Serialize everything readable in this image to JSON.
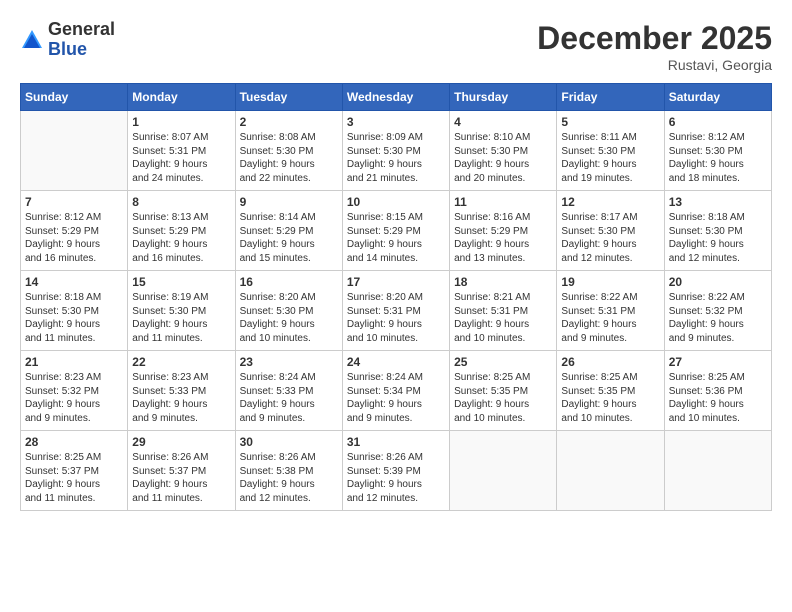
{
  "header": {
    "logo_general": "General",
    "logo_blue": "Blue",
    "month_title": "December 2025",
    "location": "Rustavi, Georgia"
  },
  "days_of_week": [
    "Sunday",
    "Monday",
    "Tuesday",
    "Wednesday",
    "Thursday",
    "Friday",
    "Saturday"
  ],
  "weeks": [
    [
      {
        "day": "",
        "info": ""
      },
      {
        "day": "1",
        "info": "Sunrise: 8:07 AM\nSunset: 5:31 PM\nDaylight: 9 hours\nand 24 minutes."
      },
      {
        "day": "2",
        "info": "Sunrise: 8:08 AM\nSunset: 5:30 PM\nDaylight: 9 hours\nand 22 minutes."
      },
      {
        "day": "3",
        "info": "Sunrise: 8:09 AM\nSunset: 5:30 PM\nDaylight: 9 hours\nand 21 minutes."
      },
      {
        "day": "4",
        "info": "Sunrise: 8:10 AM\nSunset: 5:30 PM\nDaylight: 9 hours\nand 20 minutes."
      },
      {
        "day": "5",
        "info": "Sunrise: 8:11 AM\nSunset: 5:30 PM\nDaylight: 9 hours\nand 19 minutes."
      },
      {
        "day": "6",
        "info": "Sunrise: 8:12 AM\nSunset: 5:30 PM\nDaylight: 9 hours\nand 18 minutes."
      }
    ],
    [
      {
        "day": "7",
        "info": "Sunrise: 8:12 AM\nSunset: 5:29 PM\nDaylight: 9 hours\nand 16 minutes."
      },
      {
        "day": "8",
        "info": "Sunrise: 8:13 AM\nSunset: 5:29 PM\nDaylight: 9 hours\nand 16 minutes."
      },
      {
        "day": "9",
        "info": "Sunrise: 8:14 AM\nSunset: 5:29 PM\nDaylight: 9 hours\nand 15 minutes."
      },
      {
        "day": "10",
        "info": "Sunrise: 8:15 AM\nSunset: 5:29 PM\nDaylight: 9 hours\nand 14 minutes."
      },
      {
        "day": "11",
        "info": "Sunrise: 8:16 AM\nSunset: 5:29 PM\nDaylight: 9 hours\nand 13 minutes."
      },
      {
        "day": "12",
        "info": "Sunrise: 8:17 AM\nSunset: 5:30 PM\nDaylight: 9 hours\nand 12 minutes."
      },
      {
        "day": "13",
        "info": "Sunrise: 8:18 AM\nSunset: 5:30 PM\nDaylight: 9 hours\nand 12 minutes."
      }
    ],
    [
      {
        "day": "14",
        "info": "Sunrise: 8:18 AM\nSunset: 5:30 PM\nDaylight: 9 hours\nand 11 minutes."
      },
      {
        "day": "15",
        "info": "Sunrise: 8:19 AM\nSunset: 5:30 PM\nDaylight: 9 hours\nand 11 minutes."
      },
      {
        "day": "16",
        "info": "Sunrise: 8:20 AM\nSunset: 5:30 PM\nDaylight: 9 hours\nand 10 minutes."
      },
      {
        "day": "17",
        "info": "Sunrise: 8:20 AM\nSunset: 5:31 PM\nDaylight: 9 hours\nand 10 minutes."
      },
      {
        "day": "18",
        "info": "Sunrise: 8:21 AM\nSunset: 5:31 PM\nDaylight: 9 hours\nand 10 minutes."
      },
      {
        "day": "19",
        "info": "Sunrise: 8:22 AM\nSunset: 5:31 PM\nDaylight: 9 hours\nand 9 minutes."
      },
      {
        "day": "20",
        "info": "Sunrise: 8:22 AM\nSunset: 5:32 PM\nDaylight: 9 hours\nand 9 minutes."
      }
    ],
    [
      {
        "day": "21",
        "info": "Sunrise: 8:23 AM\nSunset: 5:32 PM\nDaylight: 9 hours\nand 9 minutes."
      },
      {
        "day": "22",
        "info": "Sunrise: 8:23 AM\nSunset: 5:33 PM\nDaylight: 9 hours\nand 9 minutes."
      },
      {
        "day": "23",
        "info": "Sunrise: 8:24 AM\nSunset: 5:33 PM\nDaylight: 9 hours\nand 9 minutes."
      },
      {
        "day": "24",
        "info": "Sunrise: 8:24 AM\nSunset: 5:34 PM\nDaylight: 9 hours\nand 9 minutes."
      },
      {
        "day": "25",
        "info": "Sunrise: 8:25 AM\nSunset: 5:35 PM\nDaylight: 9 hours\nand 10 minutes."
      },
      {
        "day": "26",
        "info": "Sunrise: 8:25 AM\nSunset: 5:35 PM\nDaylight: 9 hours\nand 10 minutes."
      },
      {
        "day": "27",
        "info": "Sunrise: 8:25 AM\nSunset: 5:36 PM\nDaylight: 9 hours\nand 10 minutes."
      }
    ],
    [
      {
        "day": "28",
        "info": "Sunrise: 8:25 AM\nSunset: 5:37 PM\nDaylight: 9 hours\nand 11 minutes."
      },
      {
        "day": "29",
        "info": "Sunrise: 8:26 AM\nSunset: 5:37 PM\nDaylight: 9 hours\nand 11 minutes."
      },
      {
        "day": "30",
        "info": "Sunrise: 8:26 AM\nSunset: 5:38 PM\nDaylight: 9 hours\nand 12 minutes."
      },
      {
        "day": "31",
        "info": "Sunrise: 8:26 AM\nSunset: 5:39 PM\nDaylight: 9 hours\nand 12 minutes."
      },
      {
        "day": "",
        "info": ""
      },
      {
        "day": "",
        "info": ""
      },
      {
        "day": "",
        "info": ""
      }
    ]
  ]
}
